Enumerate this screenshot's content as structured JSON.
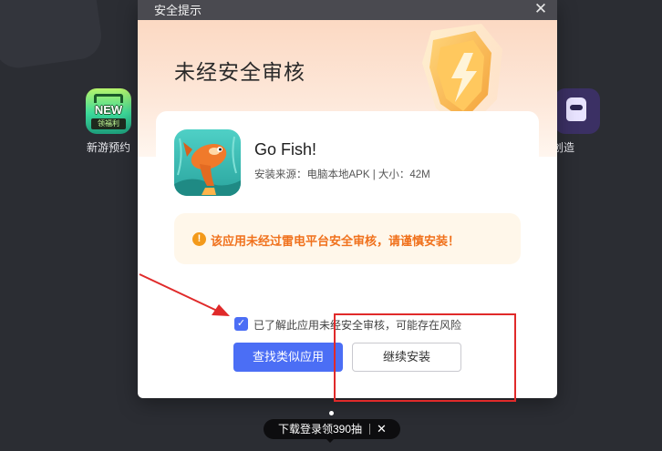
{
  "desktop": {
    "apps": [
      {
        "label": "新游预约",
        "badge_top": "NEW",
        "badge_bottom": "领福利"
      },
      {
        "label": "空创造"
      }
    ]
  },
  "dialog": {
    "title": "安全提示",
    "close_symbol": "✕",
    "header_title": "未经安全审核",
    "app": {
      "name": "Go Fish!",
      "meta": "安装来源：电脑本地APK | 大小：42M"
    },
    "warning": {
      "icon": "!",
      "text": "该应用未经过雷电平台安全审核，请谨慎安装！"
    },
    "confirm": {
      "checked": true,
      "check_symbol": "✓",
      "text": "已了解此应用未经安全审核，可能存在风险"
    },
    "buttons": {
      "find_similar": "查找类似应用",
      "continue_install": "继续安装"
    }
  },
  "promo": {
    "text": "下载登录领390抽",
    "close_symbol": "✕"
  },
  "colors": {
    "primary": "#4b6ef5",
    "warning_text": "#f0711c",
    "annotation_red": "#e02a2a",
    "header_gradient_top": "#fcd9c3"
  }
}
